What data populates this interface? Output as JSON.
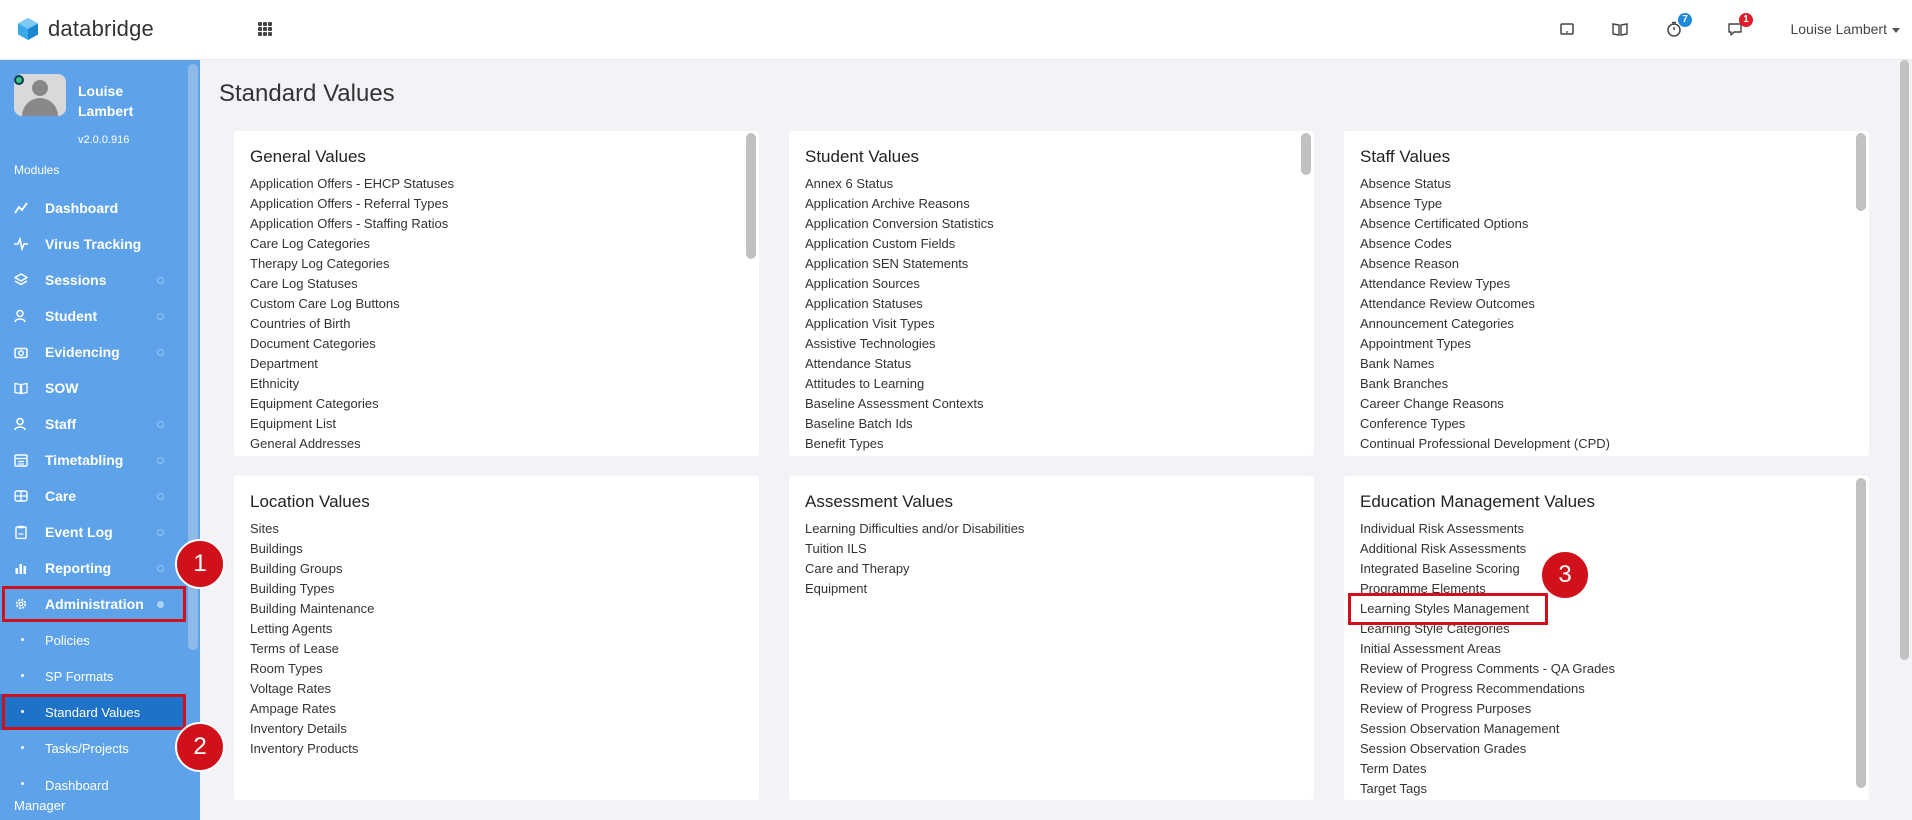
{
  "app": {
    "brand": "databridge",
    "user_menu": "Louise Lambert"
  },
  "topbar": {
    "icons": [
      {
        "name": "tablet-icon",
        "badge": null
      },
      {
        "name": "book-icon",
        "badge": null
      },
      {
        "name": "timer-icon",
        "badge": "7",
        "badge_color": "#1e88d9"
      },
      {
        "name": "chat-icon",
        "badge": "1",
        "badge_color": "#e01b2a"
      }
    ]
  },
  "sidebar": {
    "profile": {
      "name": "Louise Lambert",
      "version": "v2.0.0.916"
    },
    "modules_label": "Modules",
    "items": [
      {
        "label": "Dashboard",
        "icon": "chart-line-icon",
        "expandable": false
      },
      {
        "label": "Virus Tracking",
        "icon": "heartbeat-icon",
        "expandable": false
      },
      {
        "label": "Sessions",
        "icon": "layers-icon",
        "expandable": true
      },
      {
        "label": "Student",
        "icon": "users-icon",
        "expandable": true
      },
      {
        "label": "Evidencing",
        "icon": "camera-icon",
        "expandable": true
      },
      {
        "label": "SOW",
        "icon": "book-open-icon",
        "expandable": false
      },
      {
        "label": "Staff",
        "icon": "users-icon",
        "expandable": true
      },
      {
        "label": "Timetabling",
        "icon": "calendar-icon",
        "expandable": true
      },
      {
        "label": "Care",
        "icon": "care-icon",
        "expandable": true
      },
      {
        "label": "Event Log",
        "icon": "clipboard-icon",
        "expandable": true
      },
      {
        "label": "Reporting",
        "icon": "bar-chart-icon",
        "expandable": true
      },
      {
        "label": "Administration",
        "icon": "gear-icon",
        "expandable": true
      }
    ],
    "admin_subitems": [
      {
        "label": "Policies"
      },
      {
        "label": "SP Formats"
      },
      {
        "label": "Standard Values",
        "active": true
      },
      {
        "label": "Tasks/Projects"
      },
      {
        "label": "Dashboard Manager"
      }
    ]
  },
  "annotations": {
    "step1": "1",
    "step2": "2",
    "step3": "3",
    "color": "#d0101a"
  },
  "main": {
    "title": "Standard Values",
    "cards": [
      {
        "title": "General Values",
        "items": [
          "Application Offers - EHCP Statuses",
          "Application Offers - Referral Types",
          "Application Offers - Staffing Ratios",
          "Care Log Categories",
          "Therapy Log Categories",
          "Care Log Statuses",
          "Custom Care Log Buttons",
          "Countries of Birth",
          "Document Categories",
          "Department",
          "Ethnicity",
          "Equipment Categories",
          "Equipment List",
          "General Addresses"
        ]
      },
      {
        "title": "Student Values",
        "items": [
          "Annex 6 Status",
          "Application Archive Reasons",
          "Application Conversion Statistics",
          "Application Custom Fields",
          "Application SEN Statements",
          "Application Sources",
          "Application Statuses",
          "Application Visit Types",
          "Assistive Technologies",
          "Attendance Status",
          "Attitudes to Learning",
          "Baseline Assessment Contexts",
          "Baseline Batch Ids",
          "Benefit Types"
        ]
      },
      {
        "title": "Staff Values",
        "items": [
          "Absence Status",
          "Absence Type",
          "Absence Certificated Options",
          "Absence Codes",
          "Absence Reason",
          "Attendance Review Types",
          "Attendance Review Outcomes",
          "Announcement Categories",
          "Appointment Types",
          "Bank Names",
          "Bank Branches",
          "Career Change Reasons",
          "Conference Types",
          "Continual Professional Development (CPD)"
        ]
      },
      {
        "title": "Location Values",
        "items": [
          "Sites",
          "Buildings",
          "Building Groups",
          "Building Types",
          "Building Maintenance",
          "Letting Agents",
          "Terms of Lease",
          "Room Types",
          "Voltage Rates",
          "Ampage Rates",
          "Inventory Details",
          "Inventory Products"
        ]
      },
      {
        "title": "Assessment Values",
        "items": [
          "Learning Difficulties and/or Disabilities",
          "Tuition ILS",
          "Care and Therapy",
          "Equipment"
        ]
      },
      {
        "title": "Education Management Values",
        "items": [
          "Individual Risk Assessments",
          "Additional Risk Assessments",
          "Integrated Baseline Scoring",
          "Programme Elements",
          "Learning Styles Management",
          "Learning Style Categories",
          "Initial Assessment Areas",
          "Review of Progress Comments - QA Grades",
          "Review of Progress Recommendations",
          "Review of Progress Purposes",
          "Session Observation Management",
          "Session Observation Grades",
          "Term Dates",
          "Target Tags"
        ]
      }
    ]
  }
}
